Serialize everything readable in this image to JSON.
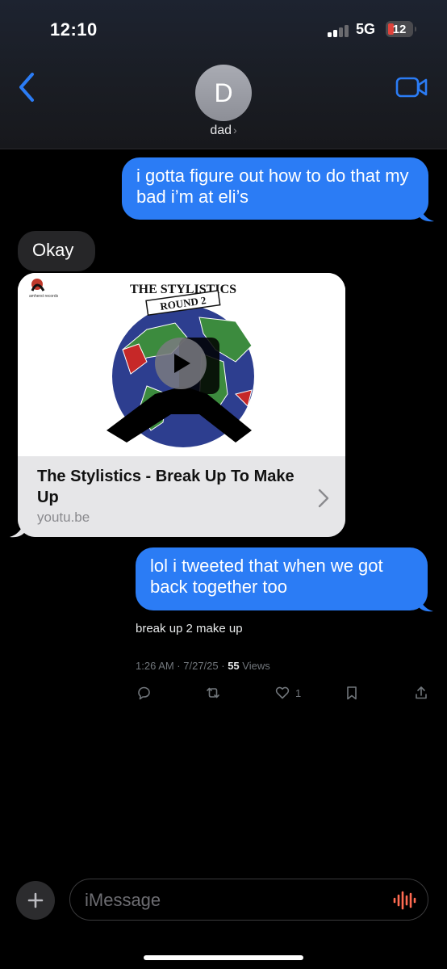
{
  "status_bar": {
    "time": "12:10",
    "network": "5G",
    "battery": "12",
    "battery_color": "#e0433c",
    "signal_icon": "signal-bars-icon"
  },
  "header": {
    "avatar_initial": "D",
    "contact_name": "dad",
    "back_icon": "chevron-left-icon",
    "video_icon": "video-camera-icon",
    "accent": "#2b7cf5"
  },
  "messages": [
    {
      "from": "me",
      "text": "i gotta figure out how to do that my bad i’m at eli’s"
    },
    {
      "from": "dad",
      "text": "Okay"
    },
    {
      "from": "me",
      "text": "lol i tweeted that when we got back together too"
    }
  ],
  "link_preview": {
    "label_brand": "amherst records",
    "album_title": "THE STYLISTICS",
    "album_subtitle": "ROUND 2",
    "title": "The Stylistics - Break Up To Make Up",
    "domain": "youtu.be",
    "play_icon": "play-icon"
  },
  "tweet": {
    "text": "break up 2 make up",
    "date": "1:26 AM · 7/27/25 · ",
    "views_count": "55",
    "views_label": " Views",
    "likes": "1",
    "icons": [
      "reply-icon",
      "retweet-icon",
      "heart-icon",
      "bookmark-icon",
      "share-icon"
    ]
  },
  "composer": {
    "placeholder": "iMessage",
    "plus_icon": "plus-icon",
    "audio_icon": "audio-waveform-icon",
    "audio_color": "#ff6b52"
  }
}
